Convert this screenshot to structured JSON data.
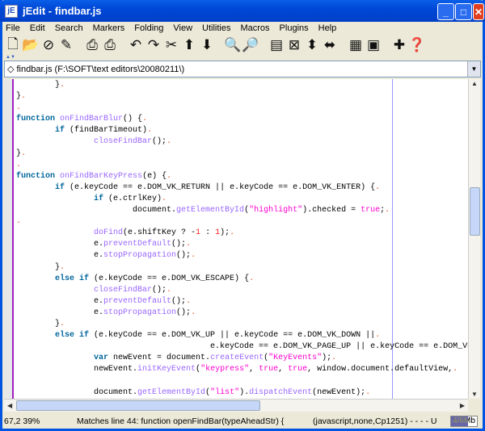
{
  "window": {
    "title": "jEdit - findbar.js",
    "logo": "jE"
  },
  "menu": [
    "File",
    "Edit",
    "Search",
    "Markers",
    "Folding",
    "View",
    "Utilities",
    "Macros",
    "Plugins",
    "Help"
  ],
  "toolbar": [
    {
      "name": "new-file-icon",
      "glyph": "🗋"
    },
    {
      "name": "open-file-icon",
      "glyph": "📂"
    },
    {
      "name": "close-icon",
      "glyph": "⊘"
    },
    {
      "name": "edit-pencil-icon",
      "glyph": "✎"
    },
    {
      "gap": true
    },
    {
      "name": "print-icon",
      "glyph": "⎙"
    },
    {
      "name": "page-setup-icon",
      "glyph": "⎙"
    },
    {
      "gap": true
    },
    {
      "name": "undo-icon",
      "glyph": "↶"
    },
    {
      "name": "redo-icon",
      "glyph": "↷"
    },
    {
      "name": "cut-icon",
      "glyph": "✂"
    },
    {
      "name": "copy-icon",
      "glyph": "⬆"
    },
    {
      "name": "paste-icon",
      "glyph": "⬇"
    },
    {
      "gap": true
    },
    {
      "name": "find-icon",
      "glyph": "🔍"
    },
    {
      "name": "find-next-icon",
      "glyph": "🔎"
    },
    {
      "gap": true
    },
    {
      "name": "new-view-icon",
      "glyph": "▤"
    },
    {
      "name": "unsplit-icon",
      "glyph": "⊠"
    },
    {
      "name": "split-horizontal-icon",
      "glyph": "⬍"
    },
    {
      "name": "split-vertical-icon",
      "glyph": "⬌"
    },
    {
      "gap": true
    },
    {
      "name": "buffer-options-icon",
      "glyph": "▦"
    },
    {
      "name": "global-options-icon",
      "glyph": "▣"
    },
    {
      "gap": true
    },
    {
      "name": "plugin-manager-icon",
      "glyph": "✚"
    },
    {
      "name": "help-icon",
      "glyph": "❓"
    }
  ],
  "buffer": {
    "label": "findbar.js (F:\\SOFT\\text editors\\20080211\\)"
  },
  "code": [
    [
      [
        "\t}",
        ""
      ],
      [
        ".",
        "d"
      ]
    ],
    [
      [
        "}",
        ""
      ],
      [
        ".",
        "d"
      ]
    ],
    [
      [
        ".",
        "d"
      ]
    ],
    [
      [
        "function",
        "k"
      ],
      [
        " ",
        ""
      ],
      [
        "onFindBarBlur",
        "f"
      ],
      [
        "() {",
        ""
      ],
      [
        ".",
        "d"
      ]
    ],
    [
      [
        "\t",
        ""
      ],
      [
        "if",
        "k"
      ],
      [
        " (findBarTimeout)",
        ""
      ],
      [
        ".",
        "d"
      ]
    ],
    [
      [
        "\t\t",
        ""
      ],
      [
        "closeFindBar",
        "f"
      ],
      [
        "();",
        ""
      ],
      [
        ".",
        "d"
      ]
    ],
    [
      [
        "}",
        ""
      ],
      [
        ".",
        "d"
      ]
    ],
    [
      [
        ".",
        "d"
      ]
    ],
    [
      [
        "function",
        "k"
      ],
      [
        " ",
        ""
      ],
      [
        "onFindBarKeyPress",
        "f"
      ],
      [
        "(e) {",
        ""
      ],
      [
        ".",
        "d"
      ]
    ],
    [
      [
        "\t",
        ""
      ],
      [
        "if",
        "k"
      ],
      [
        " (e.keyCode == e.DOM_VK_RETURN || e.keyCode == e.DOM_VK_ENTER) {",
        ""
      ],
      [
        ".",
        "d"
      ]
    ],
    [
      [
        "\t\t",
        ""
      ],
      [
        "if",
        "k"
      ],
      [
        " (e.ctrlKey)",
        ""
      ],
      [
        ".",
        "d"
      ]
    ],
    [
      [
        "\t\t\tdocument.",
        ""
      ],
      [
        "getElementById",
        "f"
      ],
      [
        "(",
        ""
      ],
      [
        "\"highlight\"",
        "s"
      ],
      [
        ").checked = ",
        ""
      ],
      [
        "true",
        "l"
      ],
      [
        ";",
        ""
      ],
      [
        ".",
        "d"
      ]
    ],
    [
      [
        ".",
        "d"
      ]
    ],
    [
      [
        "\t\t",
        ""
      ],
      [
        "doFind",
        "f"
      ],
      [
        "(e.shiftKey ? -",
        ""
      ],
      [
        "1",
        "n"
      ],
      [
        " : ",
        ""
      ],
      [
        "1",
        "n"
      ],
      [
        ");",
        ""
      ],
      [
        ".",
        "d"
      ]
    ],
    [
      [
        "\t\te.",
        ""
      ],
      [
        "preventDefault",
        "f"
      ],
      [
        "();",
        ""
      ],
      [
        ".",
        "d"
      ]
    ],
    [
      [
        "\t\te.",
        ""
      ],
      [
        "stopPropagation",
        "f"
      ],
      [
        "();",
        ""
      ],
      [
        ".",
        "d"
      ]
    ],
    [
      [
        "\t}",
        ""
      ],
      [
        ".",
        "d"
      ]
    ],
    [
      [
        "\t",
        ""
      ],
      [
        "else if",
        "k"
      ],
      [
        " (e.keyCode == e.DOM_VK_ESCAPE) {",
        ""
      ],
      [
        ".",
        "d"
      ]
    ],
    [
      [
        "\t\t",
        ""
      ],
      [
        "closeFindBar",
        "f"
      ],
      [
        "();",
        ""
      ],
      [
        ".",
        "d"
      ]
    ],
    [
      [
        "\t\te.",
        ""
      ],
      [
        "preventDefault",
        "f"
      ],
      [
        "();",
        ""
      ],
      [
        ".",
        "d"
      ]
    ],
    [
      [
        "\t\te.",
        ""
      ],
      [
        "stopPropagation",
        "f"
      ],
      [
        "();",
        ""
      ],
      [
        ".",
        "d"
      ]
    ],
    [
      [
        "\t}",
        ""
      ],
      [
        ".",
        "d"
      ]
    ],
    [
      [
        "\t",
        ""
      ],
      [
        "else if",
        "k"
      ],
      [
        " (e.keyCode == e.DOM_VK_UP || e.keyCode == e.DOM_VK_DOWN ||",
        ""
      ],
      [
        ".",
        "d"
      ]
    ],
    [
      [
        "\t\t\t\t\te.keyCode == e.DOM_VK_PAGE_UP || e.keyCode == e.DOM_VK_",
        ""
      ]
    ],
    [
      [
        "\t\t",
        ""
      ],
      [
        "var",
        "k"
      ],
      [
        " newEvent = document.",
        ""
      ],
      [
        "createEvent",
        "f"
      ],
      [
        "(",
        ""
      ],
      [
        "\"KeyEvents\"",
        "s"
      ],
      [
        ");",
        ""
      ],
      [
        ".",
        "d"
      ]
    ],
    [
      [
        "\t\tnewEvent.",
        ""
      ],
      [
        "initKeyEvent",
        "f"
      ],
      [
        "(",
        ""
      ],
      [
        "\"keypress\"",
        "s"
      ],
      [
        ", ",
        ""
      ],
      [
        "true",
        "l"
      ],
      [
        ", ",
        ""
      ],
      [
        "true",
        "l"
      ],
      [
        ", window.document.defaultView,",
        ""
      ],
      [
        ".",
        "d"
      ]
    ],
    [
      [
        "",
        ""
      ]
    ],
    [
      [
        "\t\tdocument.",
        ""
      ],
      [
        "getElementById",
        "f"
      ],
      [
        "(",
        ""
      ],
      [
        "\"list\"",
        "s"
      ],
      [
        ").",
        ""
      ],
      [
        "dispatchEvent",
        "f"
      ],
      [
        "(newEvent);",
        ""
      ],
      [
        ".",
        "d"
      ]
    ],
    [
      [
        "\t\t\te.",
        ""
      ],
      [
        "preventDefault",
        "f"
      ],
      [
        "();",
        ""
      ]
    ]
  ],
  "scroll": {
    "vertical_percent": 39
  },
  "status": {
    "caret": "67,2 39%",
    "message": "Matches line 44: function openFindBar(typeAheadStr) {",
    "mode": "(javascript,none,Cp1251) - - - - U",
    "memory": "4/6Mb",
    "memory_fraction": 0.67
  }
}
